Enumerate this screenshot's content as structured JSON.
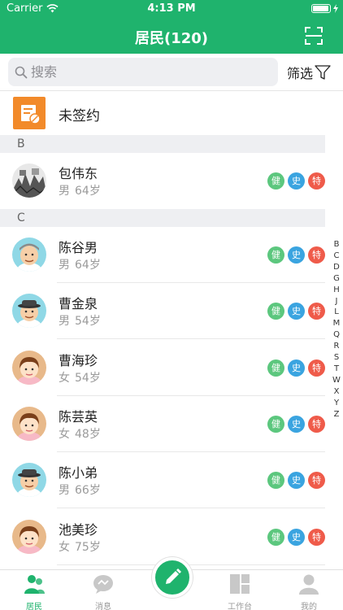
{
  "status_bar": {
    "carrier": "Carrier",
    "time": "4:13 PM",
    "battery_level": 0.95
  },
  "header": {
    "title": "居民(120)",
    "scan_icon": "scan-icon"
  },
  "search": {
    "placeholder": "搜索",
    "value": ""
  },
  "filter": {
    "label": "筛选",
    "icon": "filter-icon"
  },
  "unsigned": {
    "label": "未签约",
    "icon": "unsigned-document-icon"
  },
  "sections": [
    {
      "letter": "B",
      "residents": [
        {
          "name": "包伟东",
          "gender": "男",
          "age": "64岁",
          "avatar": "photo",
          "tags": [
            "健",
            "史",
            "特"
          ]
        }
      ]
    },
    {
      "letter": "C",
      "residents": [
        {
          "name": "陈谷男",
          "gender": "男",
          "age": "64岁",
          "avatar": "male-elder",
          "tags": [
            "健",
            "史",
            "特"
          ]
        },
        {
          "name": "曹金泉",
          "gender": "男",
          "age": "54岁",
          "avatar": "male-hat",
          "tags": [
            "健",
            "史",
            "特"
          ]
        },
        {
          "name": "曹海珍",
          "gender": "女",
          "age": "54岁",
          "avatar": "female",
          "tags": [
            "健",
            "史",
            "特"
          ]
        },
        {
          "name": "陈芸英",
          "gender": "女",
          "age": "48岁",
          "avatar": "female",
          "tags": [
            "健",
            "史",
            "特"
          ]
        },
        {
          "name": "陈小弟",
          "gender": "男",
          "age": "66岁",
          "avatar": "male-hat",
          "tags": [
            "健",
            "史",
            "特"
          ]
        },
        {
          "name": "池美珍",
          "gender": "女",
          "age": "75岁",
          "avatar": "female",
          "tags": [
            "健",
            "史",
            "特"
          ]
        }
      ]
    }
  ],
  "tag_colors": {
    "健": "#5cc77e",
    "史": "#3aa4e0",
    "特": "#ef5b4a"
  },
  "index_letters": [
    "B",
    "C",
    "D",
    "G",
    "H",
    "J",
    "L",
    "M",
    "Q",
    "R",
    "S",
    "T",
    "W",
    "X",
    "Y",
    "Z"
  ],
  "tabs": [
    {
      "label": "居民",
      "icon": "residents-icon",
      "active": true
    },
    {
      "label": "消息",
      "icon": "message-icon",
      "active": false
    },
    {
      "label": "工作台",
      "icon": "workbench-icon",
      "active": false
    },
    {
      "label": "我的",
      "icon": "profile-icon",
      "active": false
    }
  ],
  "fab": {
    "icon": "pencil-icon"
  },
  "colors": {
    "brand": "#1fb36d",
    "accent_orange": "#f28a2a"
  }
}
